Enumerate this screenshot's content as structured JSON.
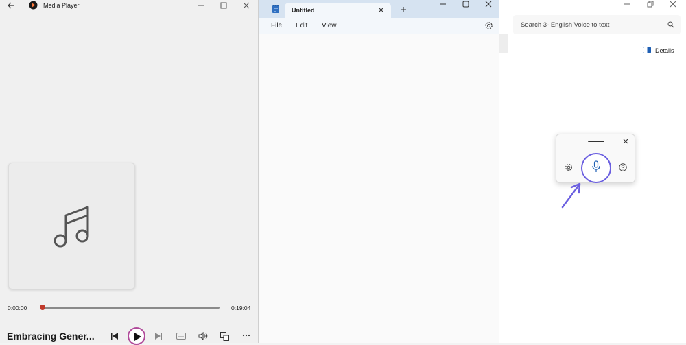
{
  "media_player": {
    "title": "Media Player",
    "current_time": "0:00:00",
    "total_time": "0:19:04",
    "progress": 0,
    "song_title": "Embracing Gener..."
  },
  "notepad": {
    "tab_title": "Untitled",
    "menu": [
      "File",
      "Edit",
      "View"
    ]
  },
  "right_window": {
    "search_placeholder": "Search 3- English Voice to text",
    "details_label": "Details"
  },
  "voice_typing": {
    "accent": "#6b5fe0"
  },
  "colors": {
    "accent": "#6b5fe0",
    "progress_thumb": "#c0392b"
  }
}
